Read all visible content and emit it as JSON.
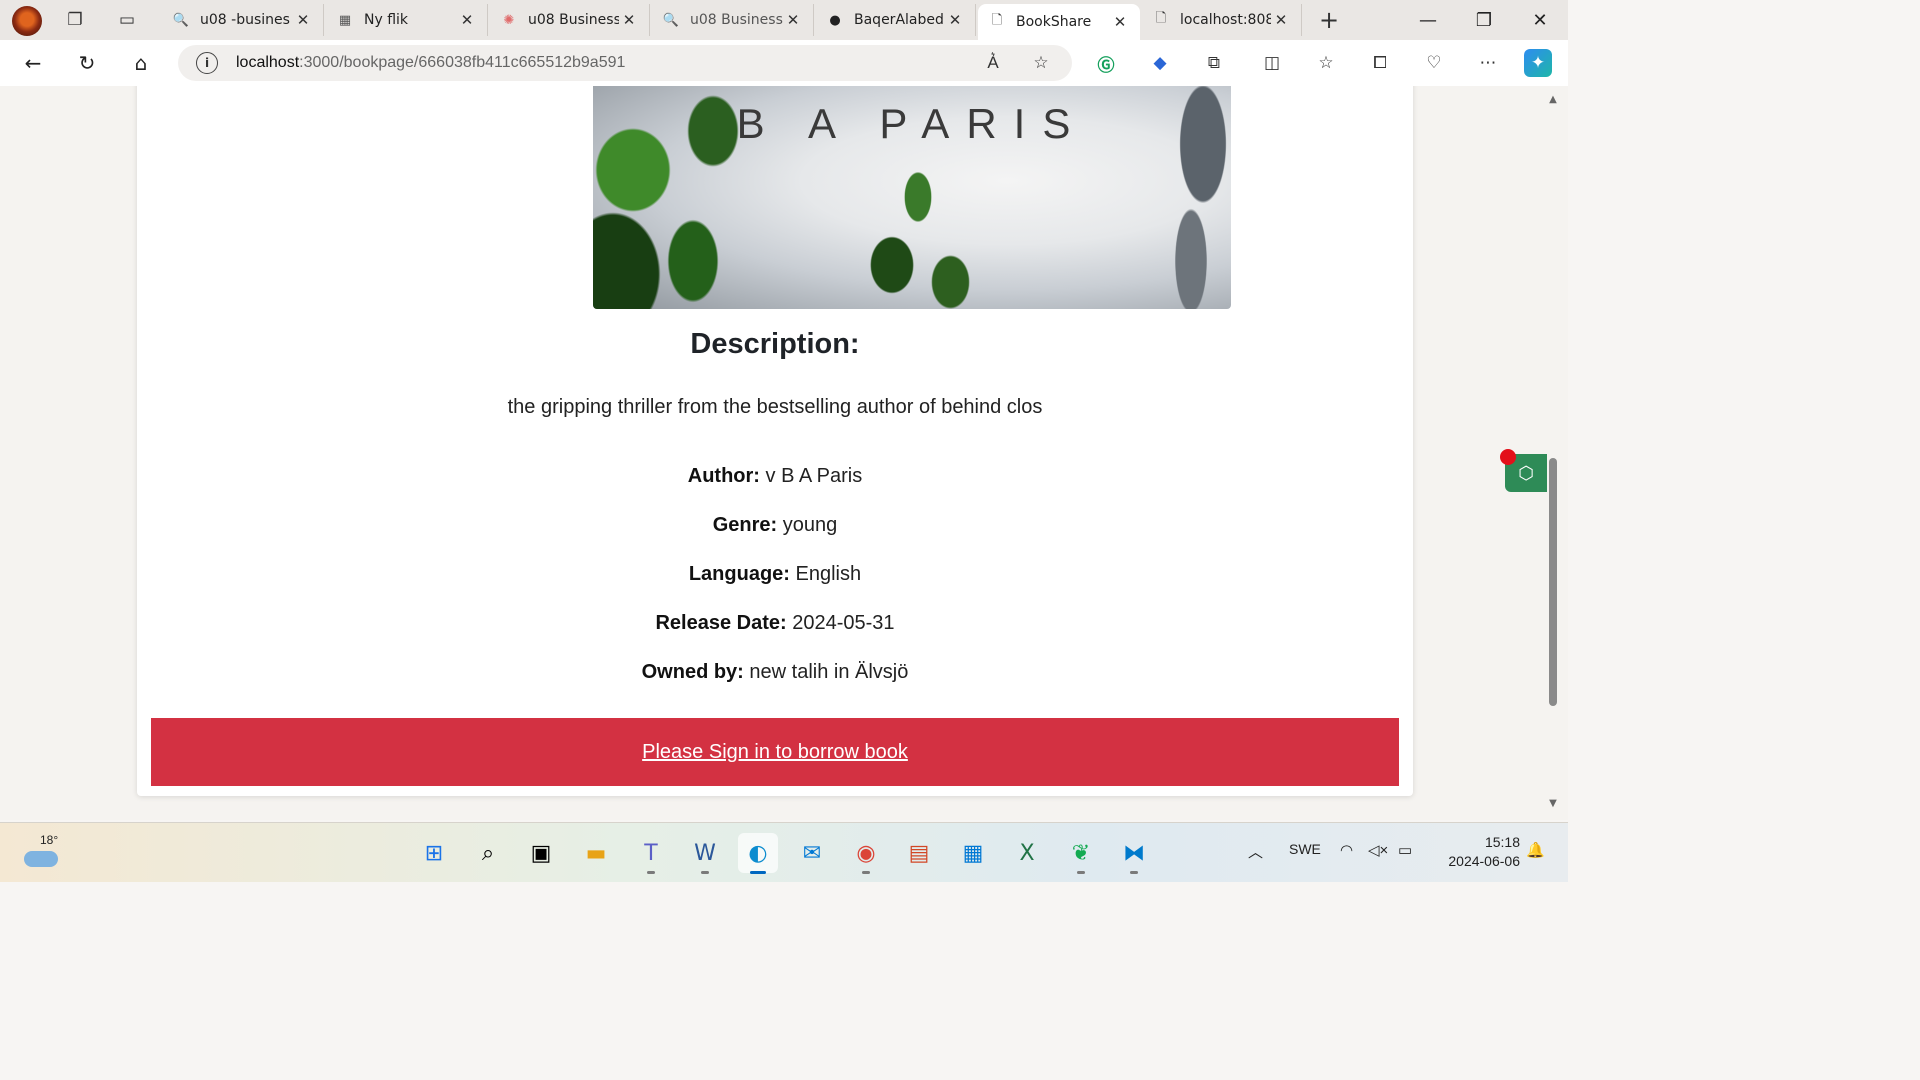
{
  "browser": {
    "tabs": [
      {
        "label": "u08 -busines",
        "icon": "search-icon"
      },
      {
        "label": "Ny flik",
        "icon": "new-tab-icon"
      },
      {
        "label": "u08 Business",
        "icon": "loading-icon"
      },
      {
        "label": "u08 Business",
        "icon": "search-icon"
      },
      {
        "label": "BaqerAlabed",
        "icon": "github-icon"
      },
      {
        "label": "BookShare",
        "icon": "page-icon",
        "active": true
      },
      {
        "label": "localhost:808",
        "icon": "page-icon"
      }
    ],
    "url_host": "localhost",
    "url_path": ":3000/bookpage/666038fb411c665512b9a591"
  },
  "book": {
    "cover_author": "B A PARIS",
    "description_heading": "Description:",
    "description": "the gripping thriller from the bestselling author of behind clos",
    "fields": {
      "author_label": "Author:",
      "author_value": "v B A Paris",
      "genre_label": "Genre:",
      "genre_value": "young",
      "language_label": "Language:",
      "language_value": "English",
      "release_label": "Release Date:",
      "release_value": "2024-05-31",
      "owner_label": "Owned by:",
      "owner_value": "new talih in Älvsjö"
    },
    "borrow_label": "Please Sign in to borrow book",
    "borrow_color": "#d33142"
  },
  "taskbar": {
    "weather_temp": "18°",
    "language": "SWE",
    "time": "15:18",
    "date": "2024-06-06"
  }
}
